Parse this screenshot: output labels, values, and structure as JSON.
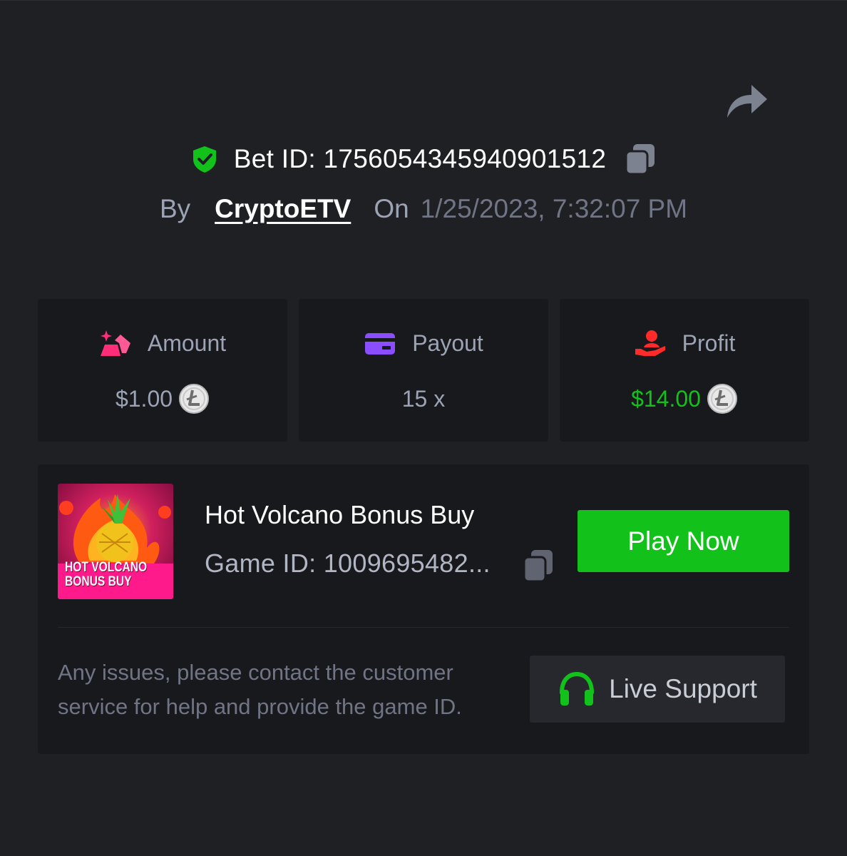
{
  "header": {
    "share_icon": "share-arrow-icon",
    "verified_icon": "shield-check-icon",
    "bet_label": "Bet ID: 1756054345940901512",
    "copy_icon": "copy-icon",
    "by_label": "By",
    "username": "CryptoETV",
    "on_label": "On",
    "datetime": "1/25/2023, 7:32:07 PM"
  },
  "stats": [
    {
      "title": "Amount",
      "value": "$1.00",
      "icon": "gold-bars-icon",
      "coin_icon": "litecoin-icon",
      "color": "#9ba3b4"
    },
    {
      "title": "Payout",
      "value": "15 x",
      "icon": "credit-card-icon",
      "color": "#9ba3b4"
    },
    {
      "title": "Profit",
      "value": "$14.00",
      "icon": "hand-user-icon",
      "coin_icon": "litecoin-icon",
      "color": "#12c11a"
    }
  ],
  "game": {
    "thumbnail_text_line1": "HOT VOLCANO",
    "thumbnail_text_line2": "BONUS BUY",
    "title": "Hot Volcano Bonus Buy",
    "game_id_label": "Game ID: 1009695482...",
    "play_button_label": "Play Now"
  },
  "support": {
    "help_text": "Any issues, please contact the customer service for help and provide the game ID.",
    "button_label": "Live Support",
    "button_icon": "headset-icon"
  },
  "colors": {
    "background": "#1f2024",
    "card": "#18191c",
    "accent_green": "#12c11a",
    "amount_icon": "#ff2d7a",
    "payout_icon": "#8a4dff",
    "profit_icon": "#ff2a2a"
  }
}
